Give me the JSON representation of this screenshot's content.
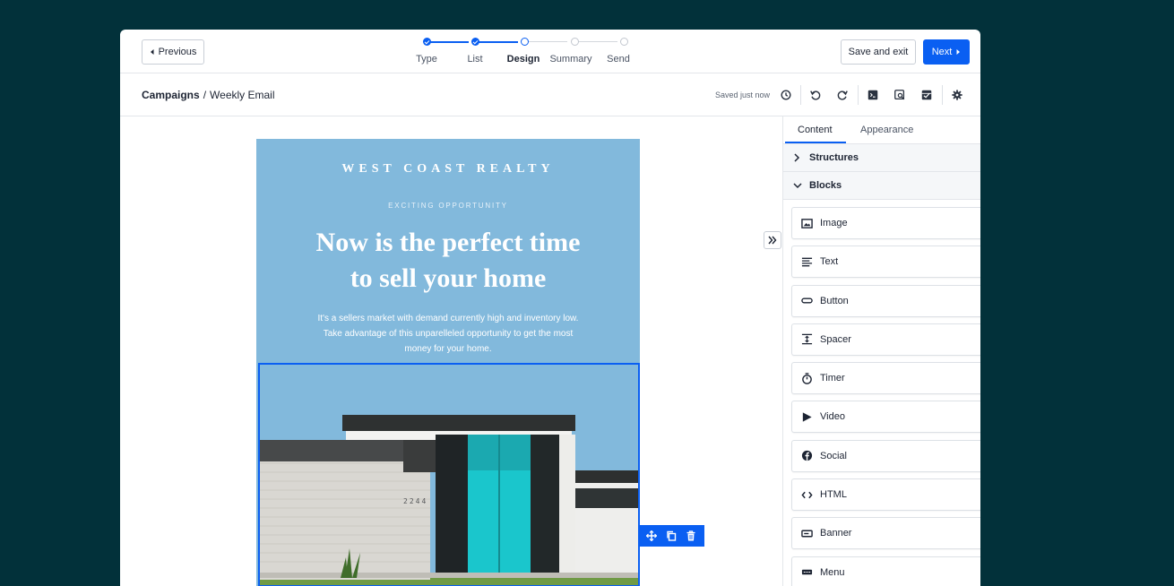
{
  "topbar": {
    "previous_label": "Previous",
    "save_exit_label": "Save and exit",
    "next_label": "Next",
    "steps": [
      {
        "label": "Type",
        "state": "done"
      },
      {
        "label": "List",
        "state": "done"
      },
      {
        "label": "Design",
        "state": "current"
      },
      {
        "label": "Summary",
        "state": "todo"
      },
      {
        "label": "Send",
        "state": "todo"
      }
    ]
  },
  "breadcrumb": {
    "root": "Campaigns",
    "separator": "/",
    "current": "Weekly Email"
  },
  "toolbar": {
    "saved_status": "Saved just now",
    "icons": [
      "history-icon",
      "undo-icon",
      "redo-icon",
      "code-preview-icon",
      "preview-icon",
      "test-send-icon",
      "settings-icon"
    ]
  },
  "email": {
    "brand": "WEST COAST REALTY",
    "eyebrow": "EXCITING OPPORTUNITY",
    "headline_line1": "Now is the perfect time",
    "headline_line2": "to sell your home",
    "lede_line1": "It's a sellers market with demand currently high and inventory low.",
    "lede_line2": "Take advantage of this unparelleled opportunity to get the most",
    "lede_line3": "money for your home.",
    "house_number": "2244"
  },
  "block_actions": [
    "move-icon",
    "duplicate-icon",
    "delete-icon"
  ],
  "panel": {
    "tabs": [
      "Content",
      "Appearance"
    ],
    "active_tab": "Content",
    "sections": [
      "Structures",
      "Blocks"
    ],
    "blocks": [
      {
        "label": "Image",
        "icon": "image-icon"
      },
      {
        "label": "Text",
        "icon": "text-icon"
      },
      {
        "label": "Button",
        "icon": "button-icon"
      },
      {
        "label": "Spacer",
        "icon": "spacer-icon"
      },
      {
        "label": "Timer",
        "icon": "timer-icon"
      },
      {
        "label": "Video",
        "icon": "video-icon"
      },
      {
        "label": "Social",
        "icon": "social-icon"
      },
      {
        "label": "HTML",
        "icon": "html-icon"
      },
      {
        "label": "Banner",
        "icon": "banner-icon"
      },
      {
        "label": "Menu",
        "icon": "menu-icon"
      }
    ]
  },
  "colors": {
    "accent": "#0a5ff2",
    "backdrop": "#02313a",
    "email_bg": "#82b9dc"
  }
}
